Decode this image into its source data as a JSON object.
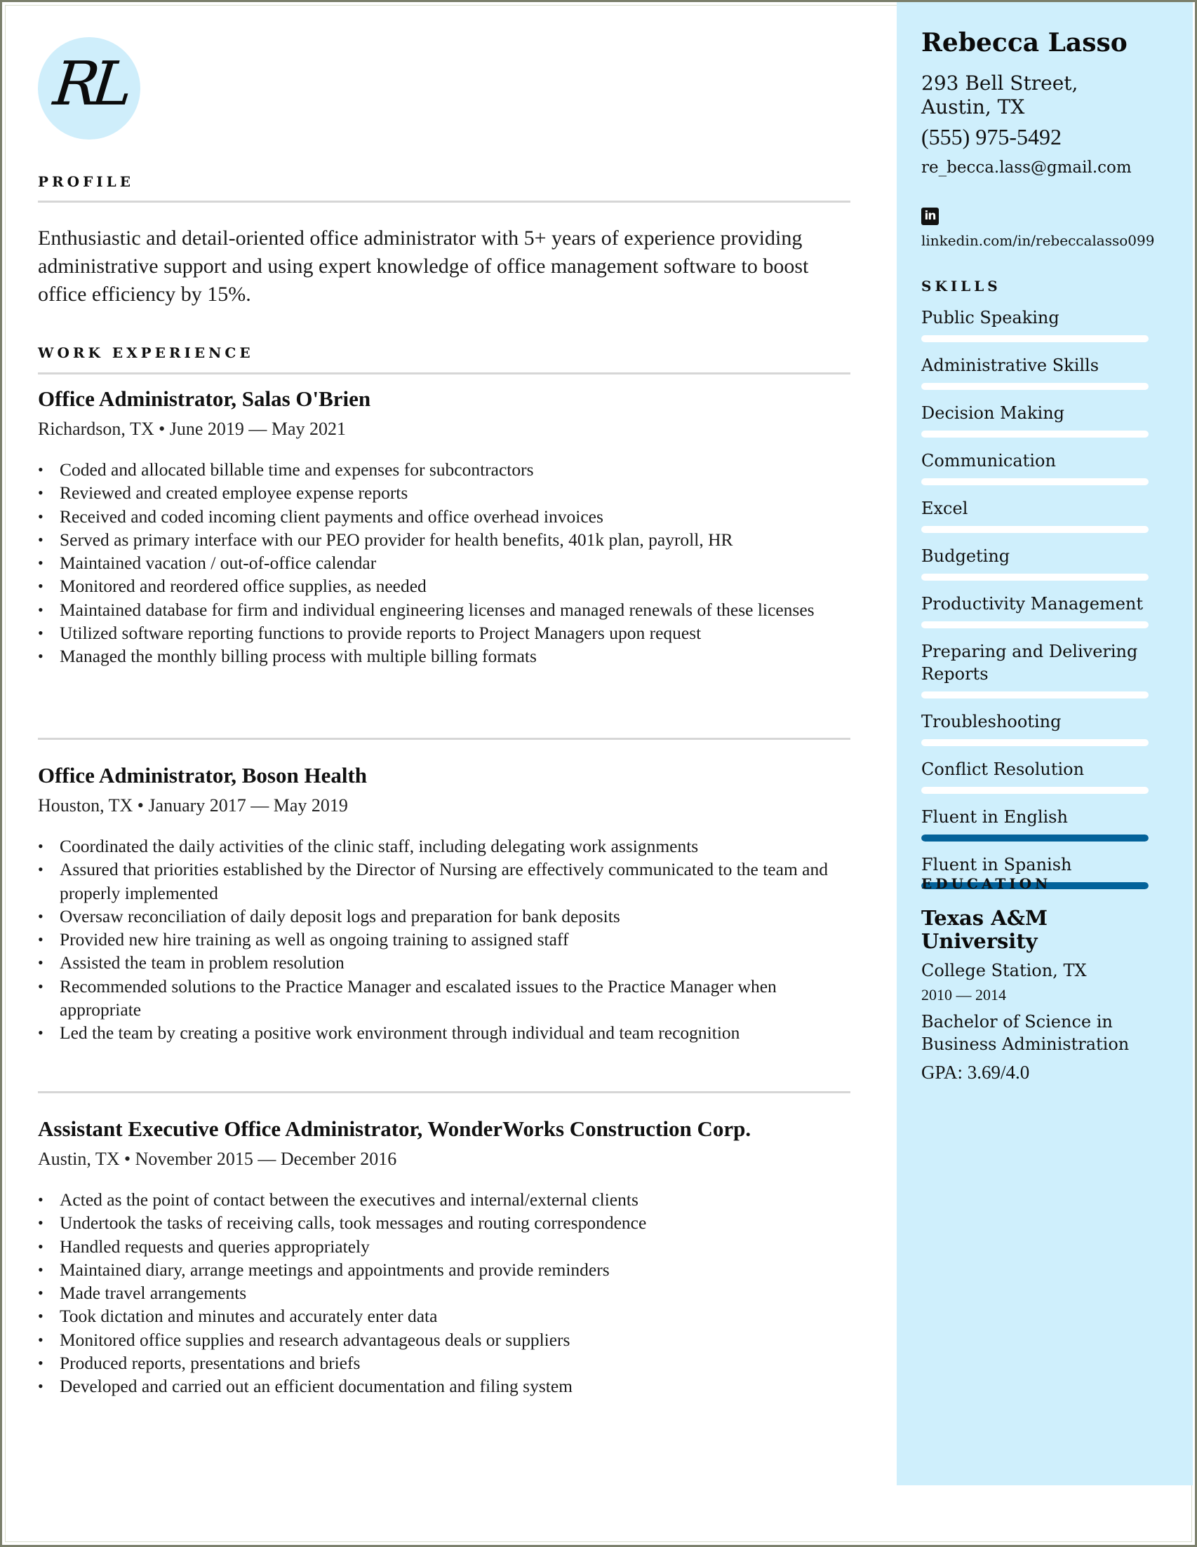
{
  "logo": {
    "initials": "RL"
  },
  "profile": {
    "label": "PROFILE",
    "text": "Enthusiastic and detail-oriented office administrator with 5+ years of experience providing administrative support and using expert knowledge of office management software to boost office efficiency by 15%."
  },
  "work": {
    "label": "WORK EXPERIENCE",
    "jobs": [
      {
        "title": "Office Administrator, Salas O'Brien",
        "meta": "Richardson, TX • June 2019 — May 2021",
        "bullets": [
          "Coded and allocated billable time and expenses for subcontractors",
          "Reviewed and created employee expense reports",
          "Received and coded incoming client payments and office overhead invoices",
          "Served as primary interface with our PEO provider for health benefits, 401k plan, payroll, HR",
          "Maintained vacation / out-of-office calendar",
          "Monitored and reordered office supplies, as needed",
          "Maintained database for firm and individual engineering licenses and managed renewals of these licenses",
          "Utilized software reporting functions to provide reports to Project Managers upon request",
          "Managed the monthly billing process with multiple billing formats"
        ]
      },
      {
        "title": "Office Administrator, Boson Health",
        "meta": "Houston, TX • January 2017 — May 2019",
        "bullets": [
          "Coordinated the daily activities of the clinic staff, including delegating work assignments",
          "Assured that priorities established by the Director of Nursing are effectively communicated to the team and properly implemented",
          "Oversaw reconciliation of daily deposit logs and preparation for bank deposits",
          "Provided new hire training as well as ongoing training to assigned staff",
          "Assisted the team in problem resolution",
          "Recommended solutions to the Practice Manager and escalated issues to the Practice Manager when appropriate",
          "Led the team by creating a positive work environment through individual and team recognition"
        ]
      },
      {
        "title": "Assistant Executive Office Administrator, WonderWorks Construction Corp.",
        "meta": "Austin, TX • November 2015 — December 2016",
        "bullets": [
          "Acted as the point of contact between the executives and internal/external clients",
          "Undertook the tasks of receiving calls, took messages and routing correspondence",
          "Handled requests and queries appropriately",
          "Maintained diary, arrange meetings and appointments and provide reminders",
          "Made travel arrangements",
          "Took dictation and minutes and accurately enter data",
          "Monitored office supplies and research advantageous deals or suppliers",
          "Produced reports, presentations and briefs",
          "Developed and carried out an efficient documentation and filing system"
        ]
      }
    ]
  },
  "contact": {
    "name": "Rebecca Lasso",
    "address_line1": "293 Bell Street,",
    "address_line2": "Austin, TX",
    "phone": "(555) 975-5492",
    "email": "re_becca.lass@gmail.com",
    "linkedin_icon": "linkedin-icon",
    "linkedin_glyph": "in",
    "linkedin_url": "linkedin.com/in/rebeccalasso099"
  },
  "skills": {
    "label": "SKILLS",
    "fill_color": "#03629a",
    "items": [
      {
        "name": "Public Speaking",
        "level": 0
      },
      {
        "name": "Administrative Skills",
        "level": 0
      },
      {
        "name": "Decision Making",
        "level": 0
      },
      {
        "name": "Communication",
        "level": 0
      },
      {
        "name": "Excel",
        "level": 0
      },
      {
        "name": "Budgeting",
        "level": 0
      },
      {
        "name": "Productivity Management",
        "level": 0
      },
      {
        "name": "Preparing and Delivering Reports",
        "level": 0
      },
      {
        "name": "Troubleshooting",
        "level": 0
      },
      {
        "name": "Conflict Resolution",
        "level": 0
      },
      {
        "name": "Fluent in English",
        "level": 1
      },
      {
        "name": "Fluent in Spanish",
        "level": 1
      }
    ]
  },
  "education": {
    "label": "EDUCATION",
    "school": "Texas A&M University",
    "location": "College Station, TX",
    "years": "2010 — 2014",
    "degree": "Bachelor of Science in Business Administration",
    "gpa": "GPA: 3.69/4.0"
  },
  "colors": {
    "sidebar_bg": "#cfeffc",
    "logo_bg": "#cfeefb",
    "rule": "#d6d6d6",
    "accent": "#03629a"
  }
}
